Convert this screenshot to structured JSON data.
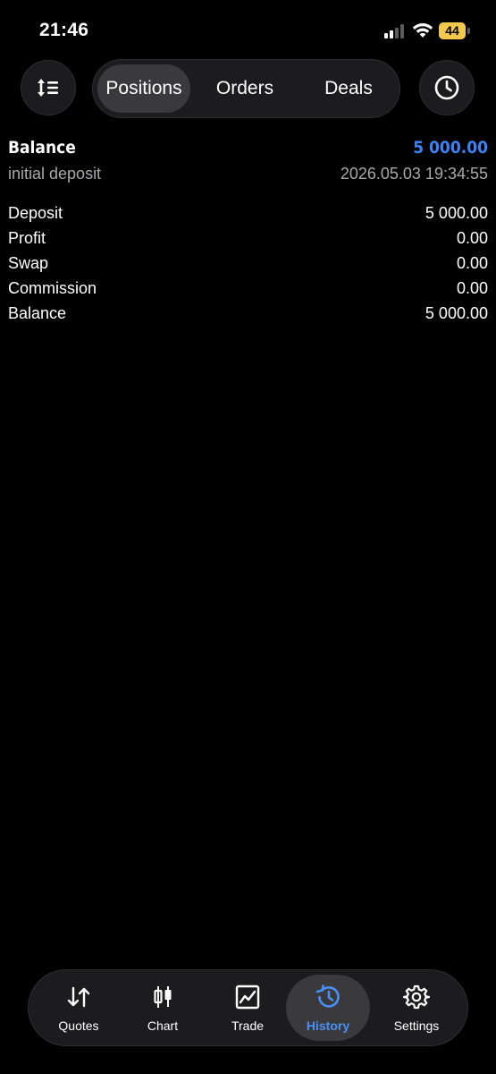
{
  "status_bar": {
    "time": "21:46",
    "battery": "44",
    "battery_color": "#f2c94c"
  },
  "segments": {
    "positions": "Positions",
    "orders": "Orders",
    "deals": "Deals",
    "selected": "Positions"
  },
  "balance_entry": {
    "title": "Balance",
    "amount": "5 000.00",
    "description": "initial deposit",
    "timestamp": "2026.05.03 19:34:55",
    "amount_color": "#3b82f6"
  },
  "summary": [
    {
      "label": "Deposit",
      "value": "5 000.00"
    },
    {
      "label": "Profit",
      "value": "0.00"
    },
    {
      "label": "Swap",
      "value": "0.00"
    },
    {
      "label": "Commission",
      "value": "0.00"
    },
    {
      "label": "Balance",
      "value": "5 000.00"
    }
  ],
  "tabbar": {
    "quotes": {
      "label": "Quotes",
      "icon": "quotes-arrows-icon"
    },
    "chart": {
      "label": "Chart",
      "icon": "candlestick-icon"
    },
    "trade": {
      "label": "Trade",
      "icon": "trade-chart-icon"
    },
    "history": {
      "label": "History",
      "icon": "history-clock-icon"
    },
    "settings": {
      "label": "Settings",
      "icon": "gear-icon"
    },
    "active": "History",
    "accent_color": "#4a90f5"
  }
}
